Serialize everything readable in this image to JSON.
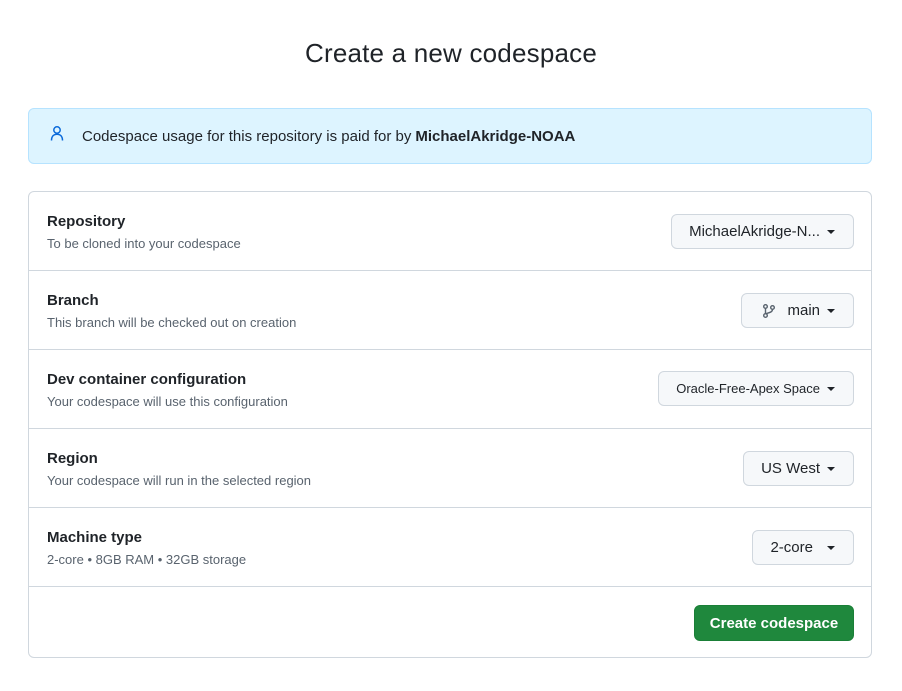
{
  "page": {
    "title": "Create a new codespace"
  },
  "flash": {
    "text": "Codespace usage for this repository is paid for by",
    "owner": "MichaelAkridge-NOAA",
    "icon": "person-icon"
  },
  "rows": [
    {
      "label": "Repository",
      "description": "To be cloned into your codespace",
      "value": "MichaelAkridge-N..."
    },
    {
      "label": "Branch",
      "description": "This branch will be checked out on creation",
      "value": "main",
      "icon": "git-branch-icon"
    },
    {
      "label": "Dev container configuration",
      "description": "Your codespace will use this configuration",
      "value": "Oracle-Free-Apex Space"
    },
    {
      "label": "Region",
      "description": "Your codespace will run in the selected region",
      "value": "US West"
    },
    {
      "label": "Machine type",
      "description": "2-core • 8GB RAM • 32GB storage",
      "value": "2-core"
    }
  ],
  "actions": {
    "create_label": "Create codespace"
  },
  "colors": {
    "primary_button": "#1f883d",
    "flash_background": "#ddf4ff",
    "flash_icon": "#0969da",
    "border": "#d0d7de"
  }
}
